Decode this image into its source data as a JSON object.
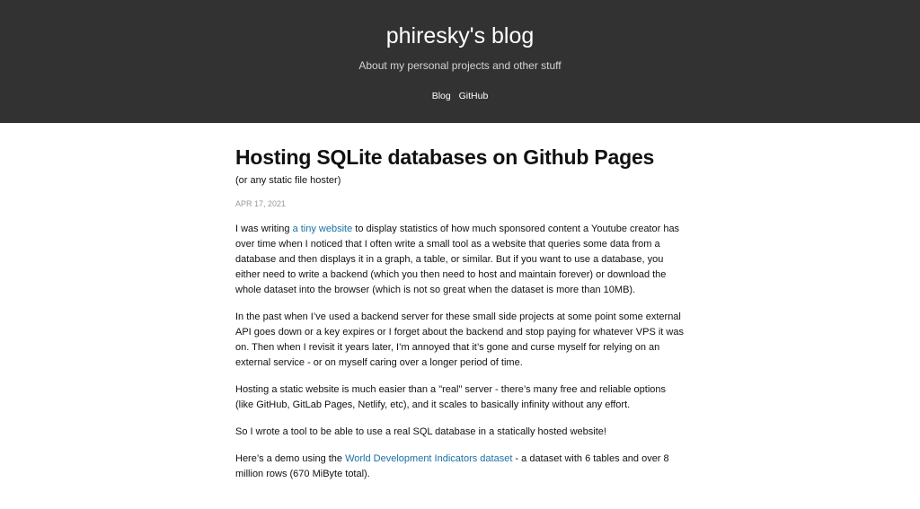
{
  "header": {
    "site_title": "phiresky's blog",
    "site_subtitle": "About my personal projects and other stuff",
    "nav": [
      {
        "label": "Blog"
      },
      {
        "label": "GitHub"
      }
    ]
  },
  "post": {
    "title": "Hosting SQLite databases on Github Pages",
    "subtitle": "(or any static file hoster)",
    "date": "APR 17, 2021",
    "p1": {
      "before": "I was writing ",
      "link": "a tiny website",
      "after": " to display statistics of how much sponsored content a Youtube creator has over time when I noticed that I often write a small tool as a website that queries some data from a database and then displays it in a graph, a table, or similar. But if you want to use a database, you either need to write a backend (which you then need to host and maintain forever) or download the whole dataset into the browser (which is not so great when the dataset is more than 10MB)."
    },
    "p2": "In the past when I’ve used a backend server for these small side projects at some point some external API goes down or a key expires or I forget about the backend and stop paying for whatever VPS it was on. Then when I revisit it years later, I’m annoyed that it’s gone and curse myself for relying on an external service - or on myself caring over a longer period of time.",
    "p3": "Hosting a static website is much easier than a \"real\" server - there’s many free and reliable options (like GitHub, GitLab Pages, Netlify, etc), and it scales to basically infinity without any effort.",
    "p4": "So I wrote a tool to be able to use a real SQL database in a statically hosted website!",
    "p5": {
      "before": "Here’s a demo using the ",
      "link": "World Development Indicators dataset",
      "after": " - a dataset with 6 tables and over 8 million rows (670 MiByte total)."
    }
  },
  "colors": {
    "header_bg": "#323232",
    "link": "#1a6fa5",
    "date": "#999999"
  }
}
